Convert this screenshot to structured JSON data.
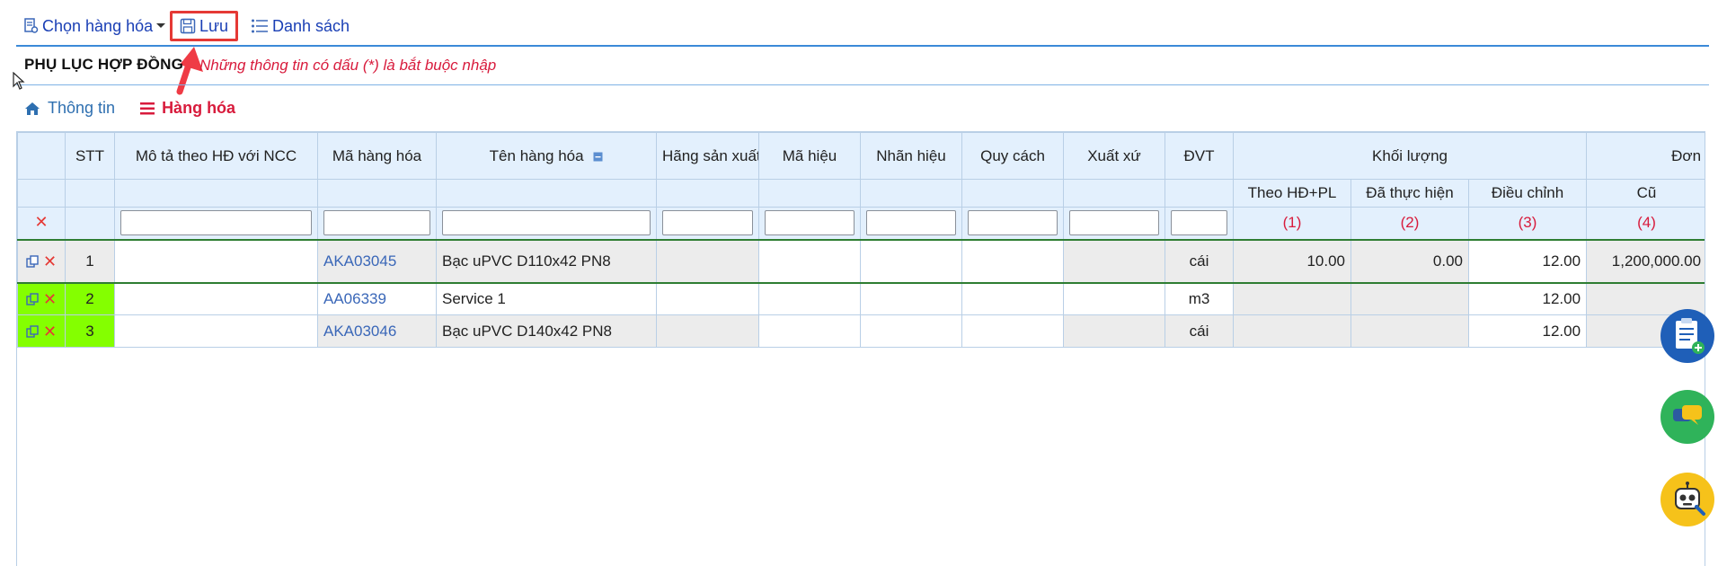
{
  "toolbar": {
    "choose_label": "Chọn hàng hóa",
    "save_label": "Lưu",
    "list_label": "Danh sách"
  },
  "section": {
    "title": "PHỤ LỤC HỢP ĐỒNG",
    "required_note": "Những thông tin có dấu (*) là bắt buộc nhập"
  },
  "tabs": {
    "info": "Thông tin",
    "goods": "Hàng hóa"
  },
  "table": {
    "headers": {
      "stt": "STT",
      "desc": "Mô tả theo HĐ với NCC",
      "code": "Mã hàng hóa",
      "name": "Tên hàng hóa",
      "maker": "Hãng sản xuất",
      "model": "Mã hiệu",
      "brand": "Nhãn hiệu",
      "spec": "Quy cách",
      "origin": "Xuất xứ",
      "unit": "ĐVT",
      "qty_group": "Khối lượng",
      "price_group": "Đơn",
      "qty_contract": "Theo HĐ+PL",
      "qty_done": "Đã thực hiện",
      "qty_adjust": "Điều chỉnh",
      "price_old": "Cũ",
      "n1": "(1)",
      "n2": "(2)",
      "n3": "(3)",
      "n4": "(4)"
    },
    "rows": [
      {
        "stt": "1",
        "desc": "",
        "code": "AKA03045",
        "name": "Bạc uPVC D110x42 PN8",
        "unit": "cái",
        "qty_contract": "10.00",
        "qty_done": "0.00",
        "qty_adjust": "12.00",
        "price_old": "1,200,000.00"
      },
      {
        "stt": "2",
        "desc": "",
        "code": "AA06339",
        "name": "Service 1",
        "unit": "m3",
        "qty_contract": "",
        "qty_done": "",
        "qty_adjust": "12.00",
        "price_old": ""
      },
      {
        "stt": "3",
        "desc": "",
        "code": "AKA03046",
        "name": "Bạc uPVC D140x42 PN8",
        "unit": "cái",
        "qty_contract": "",
        "qty_done": "",
        "qty_adjust": "12.00",
        "price_old": ""
      }
    ]
  },
  "colors": {
    "accent": "#1a3fb5",
    "required": "#d81b3c",
    "header_bg": "#e3f0fd",
    "new_row": "#84ff00",
    "selected_border": "#2e7d32"
  },
  "icons": [
    "product-select-icon",
    "save-icon",
    "list-icon",
    "home-icon",
    "menu-icon",
    "copy-icon",
    "delete-icon",
    "notes-add-icon",
    "chat-icon",
    "robot-icon"
  ]
}
